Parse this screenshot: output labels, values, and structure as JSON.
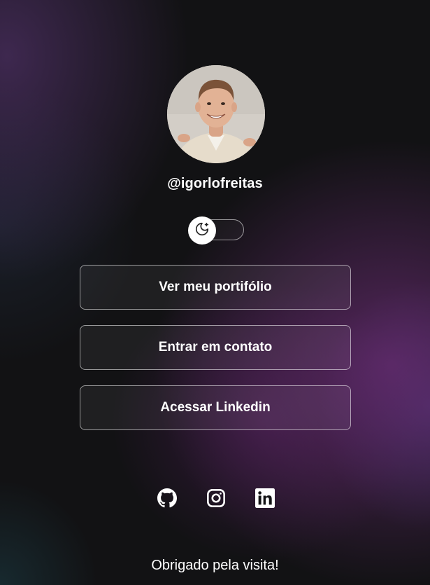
{
  "profile": {
    "handle": "@igorlofreitas",
    "avatar_alt": "Foto de perfil"
  },
  "theme_toggle": {
    "icon": "moon-stars-icon",
    "state": "dark"
  },
  "links": [
    {
      "label": "Ver meu portifólio"
    },
    {
      "label": "Entrar em contato"
    },
    {
      "label": "Acessar Linkedin"
    }
  ],
  "social": [
    {
      "icon": "github-icon"
    },
    {
      "icon": "instagram-icon"
    },
    {
      "icon": "linkedin-icon"
    }
  ],
  "footer": {
    "text": "Obrigado pela visita!"
  },
  "colors": {
    "background": "#121214",
    "accent_purple": "#6c2d76",
    "text": "#ffffff"
  }
}
